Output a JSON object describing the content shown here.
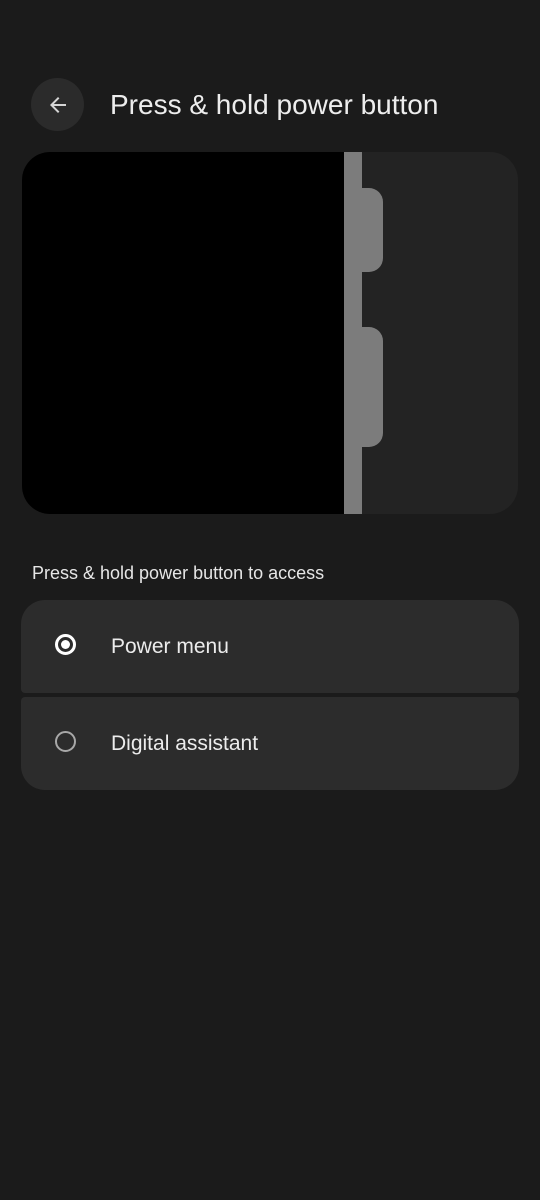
{
  "header": {
    "title": "Press & hold power button",
    "back_icon": "arrow-back-icon"
  },
  "illustration": {
    "icon": "power-button-illustration"
  },
  "section": {
    "label": "Press & hold power button to access"
  },
  "options": [
    {
      "label": "Power menu",
      "selected": true
    },
    {
      "label": "Digital assistant",
      "selected": false
    }
  ],
  "colors": {
    "background": "#1b1b1b",
    "card": "#2c2c2c",
    "illustration_bg": "#232323",
    "device_frame": "#7c7c7c"
  }
}
